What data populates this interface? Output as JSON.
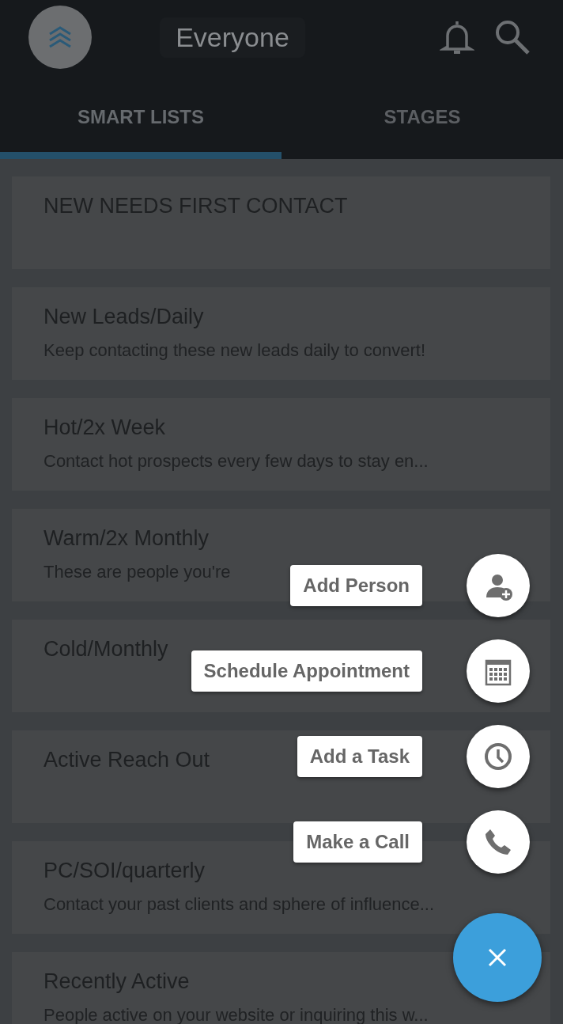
{
  "header": {
    "title": "Everyone"
  },
  "tabs": [
    {
      "label": "SMART LISTS",
      "selected": true
    },
    {
      "label": "STAGES",
      "selected": false
    }
  ],
  "smart_lists": [
    {
      "title": "NEW NEEDS FIRST CONTACT"
    },
    {
      "title": "New Leads/Daily",
      "description": "Keep contacting these new leads daily to convert!"
    },
    {
      "title": "Hot/2x Week",
      "description": "Contact hot prospects every few days to stay en..."
    },
    {
      "title": "Warm/2x Monthly",
      "description": "These are people you're"
    },
    {
      "title": "Cold/Monthly"
    },
    {
      "title": "Active Reach Out"
    },
    {
      "title": "PC/SOI/quarterly",
      "description": "Contact your past clients and sphere of influence..."
    },
    {
      "title": "Recently Active",
      "description": "People active on your website or inquiring this w..."
    }
  ],
  "actions": [
    {
      "label": "Add Person",
      "kind": "person-add"
    },
    {
      "label": "Schedule Appointment",
      "kind": "calendar"
    },
    {
      "label": "Add a Task",
      "kind": "clock"
    },
    {
      "label": "Make a Call",
      "kind": "phone"
    }
  ]
}
